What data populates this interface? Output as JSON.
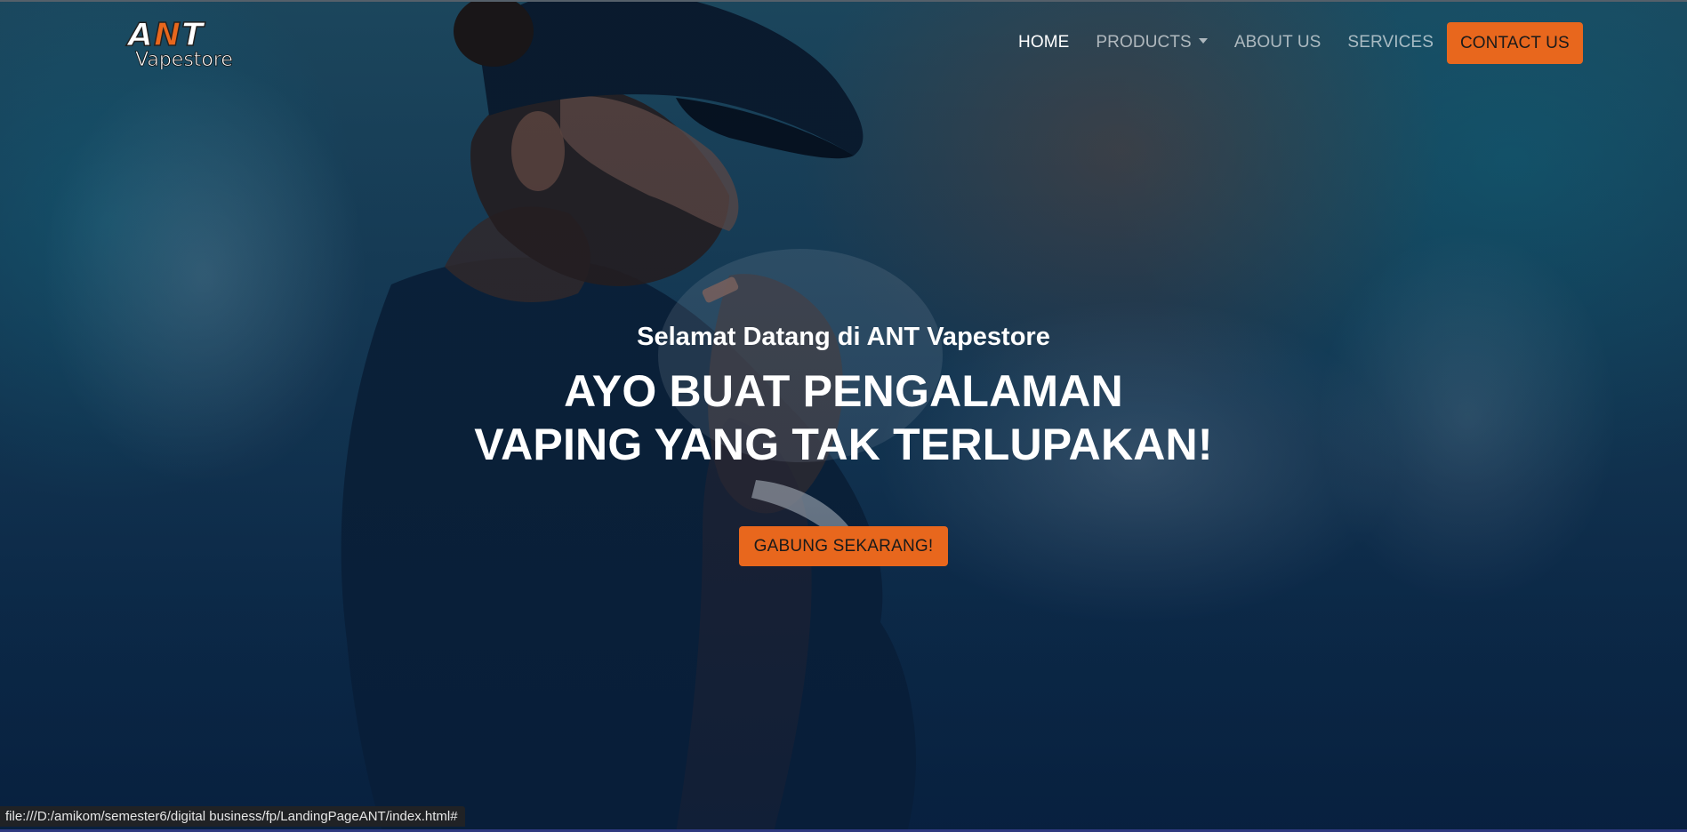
{
  "brand": {
    "logo_top": "ANT",
    "logo_bottom": "Vapestore"
  },
  "nav": {
    "items": [
      {
        "label": "HOME",
        "active": true
      },
      {
        "label": "PRODUCTS",
        "dropdown": true
      },
      {
        "label": "ABOUT US"
      },
      {
        "label": "SERVICES"
      }
    ],
    "contact_label": "CONTACT US"
  },
  "hero": {
    "subtitle": "Selamat Datang di ANT Vapestore",
    "headline_line1": "AYO BUAT PENGALAMAN",
    "headline_line2": "VAPING YANG TAK TERLUPAKAN!",
    "cta_label": "GABUNG SEKARANG!"
  },
  "status": {
    "url": "file:///D:/amikom/semester6/digital business/fp/LandingPageANT/index.html#"
  },
  "colors": {
    "accent": "#e8671d",
    "background": "#0f3050"
  }
}
